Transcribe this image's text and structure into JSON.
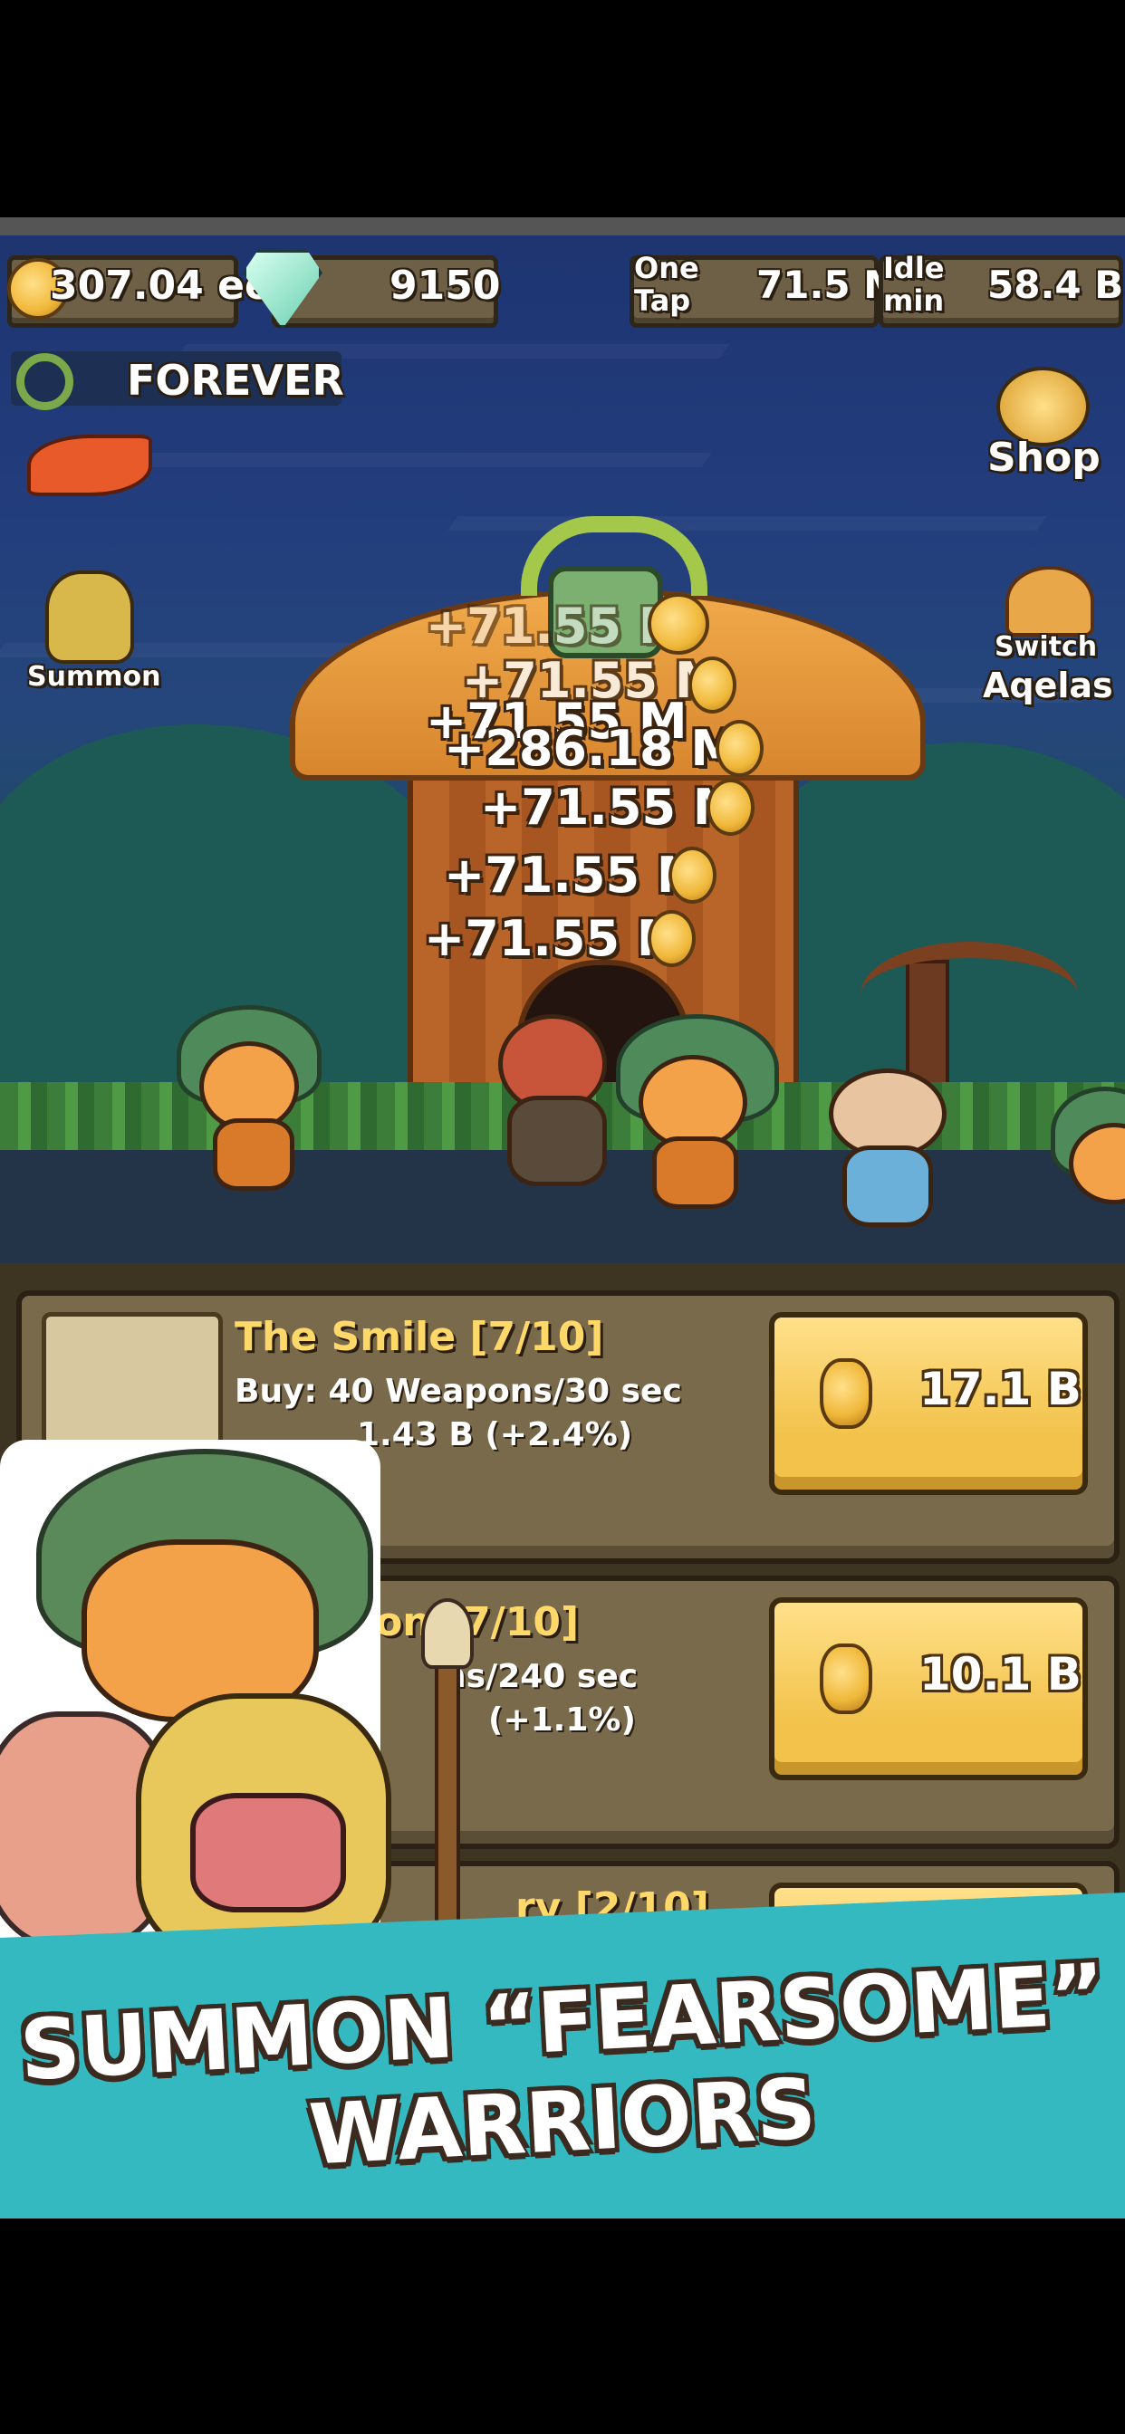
{
  "hud": {
    "gold": "307.04 ee",
    "gems": "9150",
    "one_tap_label_1": "One",
    "one_tap_label_2": "Tap",
    "one_tap_value": "71.5 M",
    "idle_label_1": "Idle",
    "idle_label_2": "min",
    "idle_value": "58.4 B"
  },
  "buff_label": "FOREVER",
  "side": {
    "summon": "Summon",
    "shop": "Shop",
    "switch": "Switch",
    "switch_name": "Aqelas"
  },
  "floating_texts": [
    "+71.55 M",
    "+71.55 M",
    "+71.55 M",
    "+286.18 M",
    "+71.55 M",
    "+71.55 M",
    "+71.55 M"
  ],
  "upgrades": [
    {
      "title": "The Smile [7/10]",
      "line1": "Buy: 40 Weapons/30 sec",
      "line2": "1.43 B (+2.4%)",
      "price": "17.1 B"
    },
    {
      "title": "ion [7/10]",
      "line1": "ns/240 sec",
      "line2": "(+1.1%)",
      "price": "10.1 B"
    },
    {
      "title": "ry [2/10]",
      "line1": "",
      "line2": "",
      "price": ""
    }
  ],
  "banner": {
    "line1": "SUMMON “FEARSOME”",
    "line2": "WARRIORS"
  },
  "colors": {
    "banner": "#35b9c0",
    "button": "#f2c24a",
    "title": "#ffd86a"
  }
}
